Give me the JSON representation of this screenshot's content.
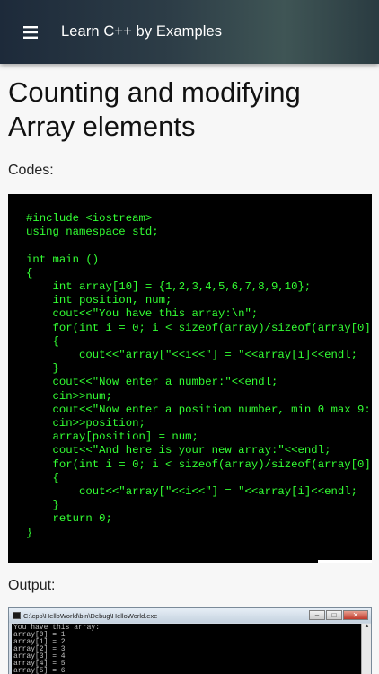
{
  "appbar": {
    "title": "Learn C++ by Examples",
    "menu_icon": "hamburger-menu-icon"
  },
  "page": {
    "title": "Counting and modifying Array elements",
    "codes_label": "Codes:",
    "output_label": "Output:"
  },
  "code": {
    "lines": [
      "#include <iostream>",
      "using namespace std;",
      "",
      "int main ()",
      "{",
      "    int array[10] = {1,2,3,4,5,6,7,8,9,10};",
      "    int position, num;",
      "    cout<<\"You have this array:\\n\";",
      "    for(int i = 0; i < sizeof(array)/sizeof(array[0]); i++)",
      "    {",
      "        cout<<\"array[\"<<i<<\"] = \"<<array[i]<<endl;",
      "    }",
      "    cout<<\"Now enter a number:\"<<endl;",
      "    cin>>num;",
      "    cout<<\"Now enter a position number, min 0 max 9:\"<<endl;",
      "    cin>>position;",
      "    array[position] = num;",
      "    cout<<\"And here is your new array:\"<<endl;",
      "    for(int i = 0; i < sizeof(array)/sizeof(array[0]); i++)",
      "    {",
      "        cout<<\"array[\"<<i<<\"] = \"<<array[i]<<endl;",
      "    }",
      "    return 0;",
      "}"
    ]
  },
  "output": {
    "window_title": "C:\\cpp\\HelloWorld\\bin\\Debug\\HelloWorld.exe",
    "console_lines": [
      "You have this array:",
      "array[0] = 1",
      "array[1] = 2",
      "array[2] = 3",
      "array[3] = 4",
      "array[4] = 5",
      "array[5] = 6",
      "array[6] = 7"
    ]
  },
  "colors": {
    "code_text": "#33ff33",
    "code_bg": "#000000",
    "page_bg": "#f7f7f7"
  }
}
